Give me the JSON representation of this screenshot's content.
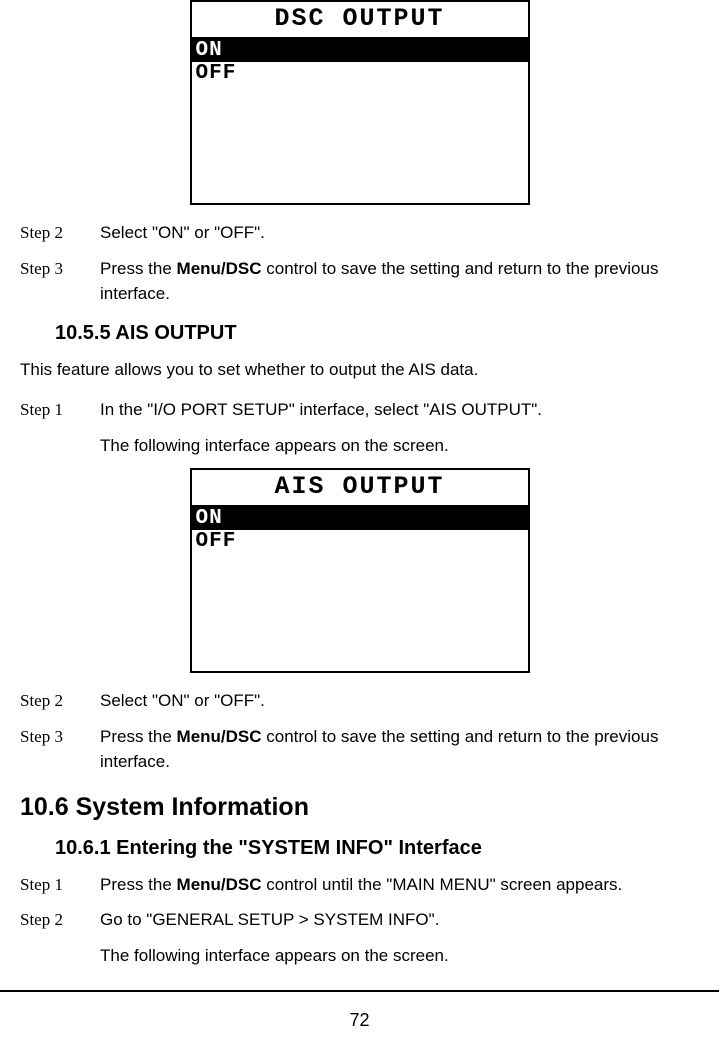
{
  "screen1": {
    "title": "DSC OUTPUT",
    "option_on": "ON",
    "option_off": "OFF"
  },
  "step2_a": {
    "label": "Step 2",
    "text": "Select \"ON\" or \"OFF\"."
  },
  "step3_a": {
    "label": "Step 3",
    "text_prefix": "Press the ",
    "text_bold": "Menu/DSC",
    "text_suffix": " control to save the setting and return to the previous interface."
  },
  "heading_1055": "10.5.5 AIS OUTPUT",
  "intro_1055": "This feature allows you to set whether to output the AIS data.",
  "step1_b": {
    "label": "Step 1",
    "text": "In the \"I/O PORT SETUP\" interface, select \"AIS OUTPUT\".",
    "text2": "The following interface appears on the screen."
  },
  "screen2": {
    "title": "AIS OUTPUT",
    "option_on": "ON",
    "option_off": "OFF"
  },
  "step2_b": {
    "label": "Step 2",
    "text": "Select \"ON\" or \"OFF\"."
  },
  "step3_b": {
    "label": "Step 3",
    "text_prefix": "Press the ",
    "text_bold": "Menu/DSC",
    "text_suffix": " control to save the setting and return to the previous interface."
  },
  "heading_106": "10.6 System Information",
  "heading_1061": "10.6.1 Entering the \"SYSTEM INFO\" Interface",
  "step1_c": {
    "label": "Step 1",
    "text_prefix": "Press the ",
    "text_bold": "Menu/DSC",
    "text_suffix": " control until the \"MAIN MENU\" screen appears."
  },
  "step2_c": {
    "label": "Step 2",
    "text": "Go to \"GENERAL SETUP > SYSTEM INFO\".",
    "text2": "The following interface appears on the screen."
  },
  "page_number": "72"
}
